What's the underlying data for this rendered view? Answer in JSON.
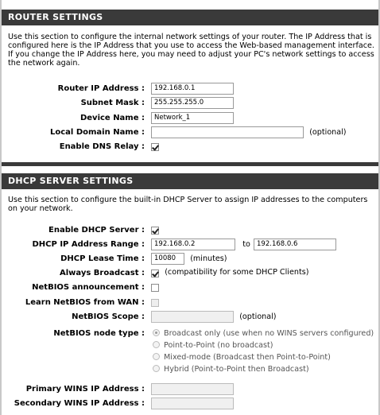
{
  "router_settings": {
    "title": "ROUTER SETTINGS",
    "description": "Use this section to configure the internal network settings of your router. The IP Address that is configured here is the IP Address that you use to access the Web-based management interface. If you change the IP Address here, you may need to adjust your PC's network settings to access the network again.",
    "router_ip": {
      "label": "Router IP Address :",
      "value": "192.168.0.1"
    },
    "subnet_mask": {
      "label": "Subnet Mask :",
      "value": "255.255.255.0"
    },
    "device_name": {
      "label": "Device Name :",
      "value": "Network_1"
    },
    "local_domain": {
      "label": "Local Domain Name :",
      "value": "",
      "hint": "(optional)"
    },
    "dns_relay": {
      "label": "Enable DNS Relay :",
      "checked": true
    }
  },
  "dhcp_settings": {
    "title": "DHCP SERVER SETTINGS",
    "description": "Use this section to configure the built-in DHCP Server to assign IP addresses to the computers on your network.",
    "enable_dhcp": {
      "label": "Enable DHCP Server :",
      "checked": true
    },
    "ip_range": {
      "label": "DHCP IP Address Range :",
      "start": "192.168.0.2",
      "to_label": "to",
      "end": "192.168.0.6"
    },
    "lease_time": {
      "label": "DHCP Lease Time :",
      "value": "10080",
      "unit": "(minutes)"
    },
    "always_broadcast": {
      "label": "Always Broadcast :",
      "checked": true,
      "hint": "(compatibility for some DHCP Clients)"
    },
    "netbios_announcement": {
      "label": "NetBIOS announcement :",
      "checked": false
    },
    "learn_netbios": {
      "label": "Learn NetBIOS from WAN :",
      "checked": false
    },
    "netbios_scope": {
      "label": "NetBIOS Scope :",
      "value": "",
      "hint": "(optional)"
    },
    "netbios_node_type": {
      "label": "NetBIOS node type :",
      "options": [
        "Broadcast only (use when no WINS servers configured)",
        "Point-to-Point (no broadcast)",
        "Mixed-mode (Broadcast then Point-to-Point)",
        "Hybrid (Point-to-Point then Broadcast)"
      ],
      "selected_index": 0
    },
    "primary_wins": {
      "label": "Primary WINS IP Address :",
      "value": ""
    },
    "secondary_wins": {
      "label": "Secondary WINS IP Address :",
      "value": ""
    }
  }
}
